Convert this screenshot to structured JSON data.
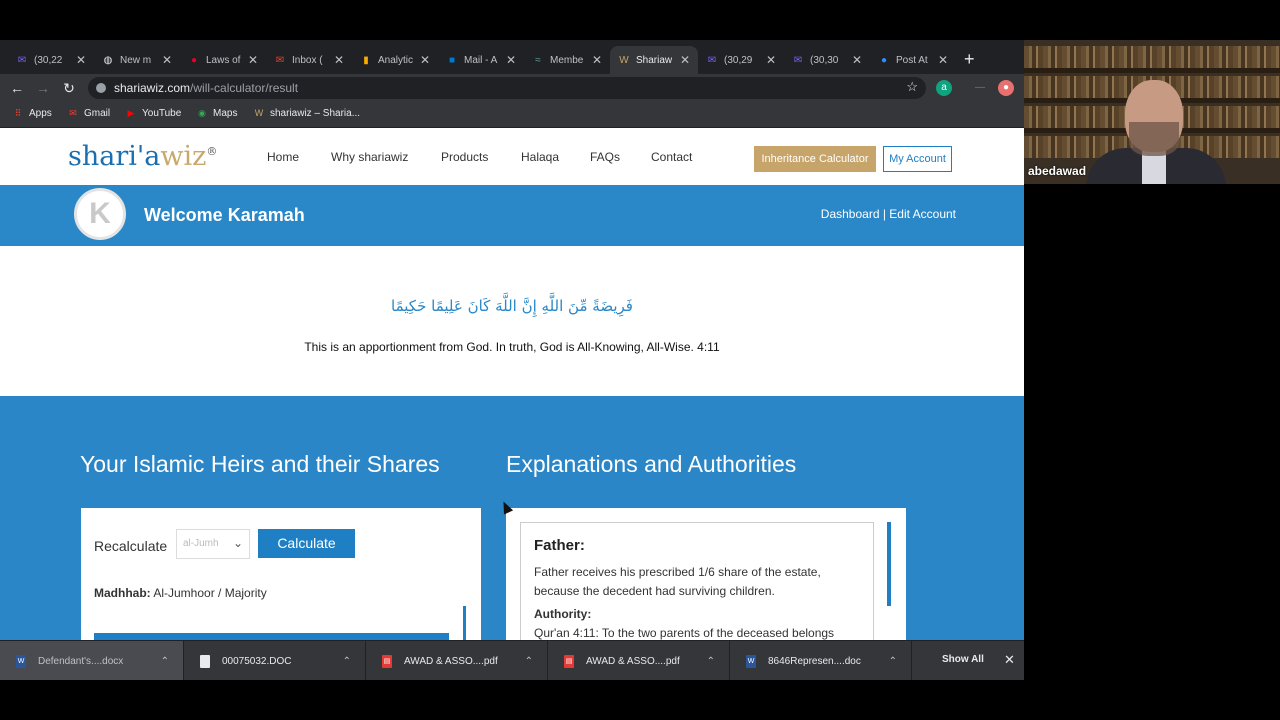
{
  "browser": {
    "tabs": [
      {
        "label": "(30,22",
        "icon": "purple-mail-icon",
        "color": "#7b61ff"
      },
      {
        "label": "New m",
        "icon": "globe-icon",
        "color": "#e8eaed"
      },
      {
        "label": "Laws of",
        "icon": "pinterest-icon",
        "color": "#e60023"
      },
      {
        "label": "Inbox (",
        "icon": "gmail-icon",
        "color": "#ea4335"
      },
      {
        "label": "Analytic",
        "icon": "analytics-icon",
        "color": "#f9ab00"
      },
      {
        "label": "Mail - A",
        "icon": "outlook-icon",
        "color": "#0078d4"
      },
      {
        "label": "Membe",
        "icon": "member-icon",
        "color": "#5f9ea0"
      },
      {
        "label": "Shariaw",
        "icon": "shariawiz-icon",
        "color": "#c6a46a"
      },
      {
        "label": "(30,29",
        "icon": "purple-mail-icon",
        "color": "#7b61ff"
      },
      {
        "label": "(30,30",
        "icon": "purple-mail-icon",
        "color": "#7b61ff"
      },
      {
        "label": "Post At",
        "icon": "zoom-icon",
        "color": "#2d8cff"
      }
    ],
    "url_host": "shariawiz.com",
    "url_path": "/will-calculator/result",
    "bookmarks": [
      {
        "label": "Apps",
        "icon": "apps-grid-icon"
      },
      {
        "label": "Gmail",
        "icon": "gmail-icon"
      },
      {
        "label": "YouTube",
        "icon": "youtube-icon"
      },
      {
        "label": "Maps",
        "icon": "maps-pin-icon"
      },
      {
        "label": "shariawiz – Sharia...",
        "icon": "shariawiz-icon"
      }
    ]
  },
  "site": {
    "logo_main": "shari'a",
    "logo_accent": "wiz",
    "logo_reg": "®",
    "nav": [
      "Home",
      "Why shariawiz",
      "Products",
      "Halaqa",
      "FAQs",
      "Contact"
    ],
    "inheritance_button": "Inheritance Calculator",
    "account_button": "My Account",
    "avatar_letter": "K",
    "welcome": "Welcome Karamah",
    "dashboard_links": "Dashboard | Edit Account",
    "arabic_verse": "فَرِيضَةً مِّنَ اللَّهِ إِنَّ اللَّهَ كَانَ عَلِيمًا حَكِيمًا",
    "translation": "This is an apportionment from God. In truth, God is All-Knowing, All-Wise. 4:11",
    "heirs_title": "Your Islamic Heirs and their Shares",
    "explanations_title": "Explanations and Authorities",
    "recalculate_label": "Recalculate",
    "madhhab_select_value": "al-Jumh",
    "calculate_button": "Calculate",
    "madhhab_label": "Madhhab:",
    "madhhab_value": "Al-Jumhoor / Majority",
    "explanation": {
      "heir": "Father:",
      "text": "Father receives his prescribed 1/6 share of the estate, because the decedent had surviving children.",
      "authority_label": "Authority:",
      "authority_text": "Qur'an 4:11: To the two parents of the deceased belongs"
    },
    "colors": {
      "brand_blue": "#2a87c8",
      "gold": "#c6a46a"
    }
  },
  "downloads": {
    "items": [
      {
        "name": "Defendant's....docx",
        "icon": "word-doc-icon"
      },
      {
        "name": "00075032.DOC",
        "icon": "doc-file-icon"
      },
      {
        "name": "AWAD & ASSO....pdf",
        "icon": "pdf-icon"
      },
      {
        "name": "AWAD & ASSO....pdf",
        "icon": "pdf-icon"
      },
      {
        "name": "8646Represen....doc",
        "icon": "word-doc-icon"
      }
    ],
    "show_all": "Show All"
  },
  "video": {
    "participant_name": "abedawad"
  }
}
